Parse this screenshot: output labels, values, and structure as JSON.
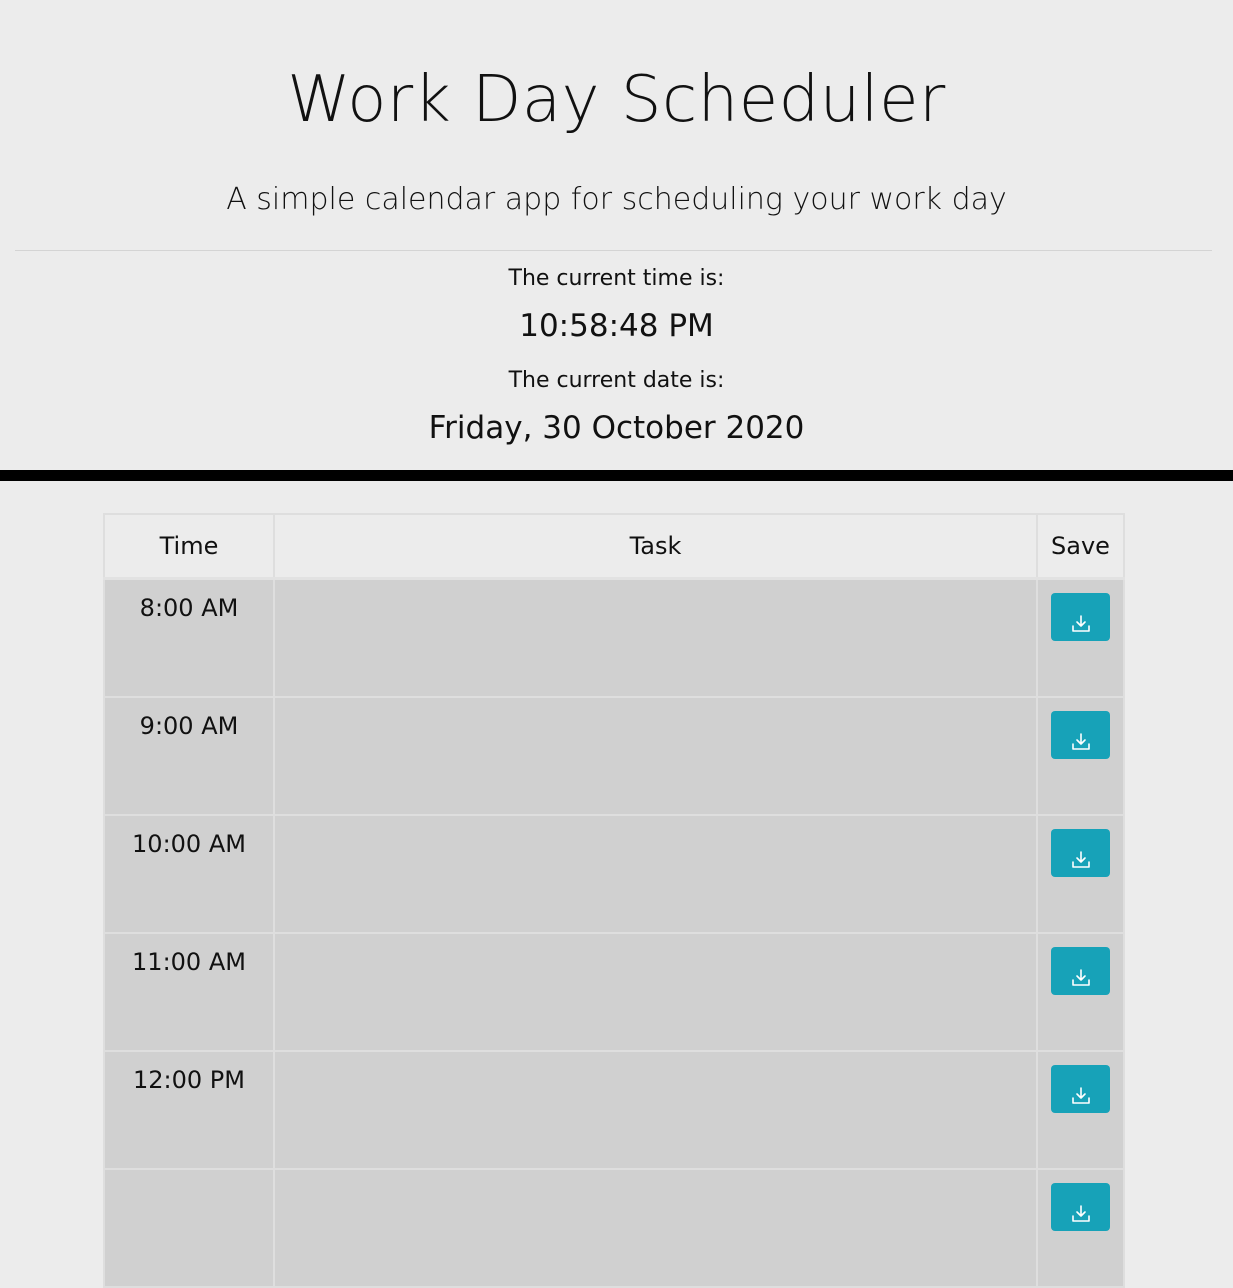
{
  "header": {
    "title": "Work Day Scheduler",
    "subtitle": "A simple calendar app for scheduling your work day",
    "time_label": "The current time is:",
    "time_value": "10:58:48 PM",
    "date_label": "The current date is:",
    "date_value": "Friday, 30 October 2020"
  },
  "table": {
    "columns": [
      "Time",
      "Task",
      "Save"
    ],
    "rows": [
      {
        "hour": "8:00 AM",
        "task": ""
      },
      {
        "hour": "9:00 AM",
        "task": ""
      },
      {
        "hour": "10:00 AM",
        "task": ""
      },
      {
        "hour": "11:00 AM",
        "task": ""
      },
      {
        "hour": "12:00 PM",
        "task": ""
      },
      {
        "hour": "",
        "task": ""
      }
    ],
    "save_icon": "save-download-icon"
  },
  "colors": {
    "background": "#ececec",
    "row_past": "#d0d0d0",
    "save_button": "#17a2b8",
    "rule": "#000000"
  }
}
